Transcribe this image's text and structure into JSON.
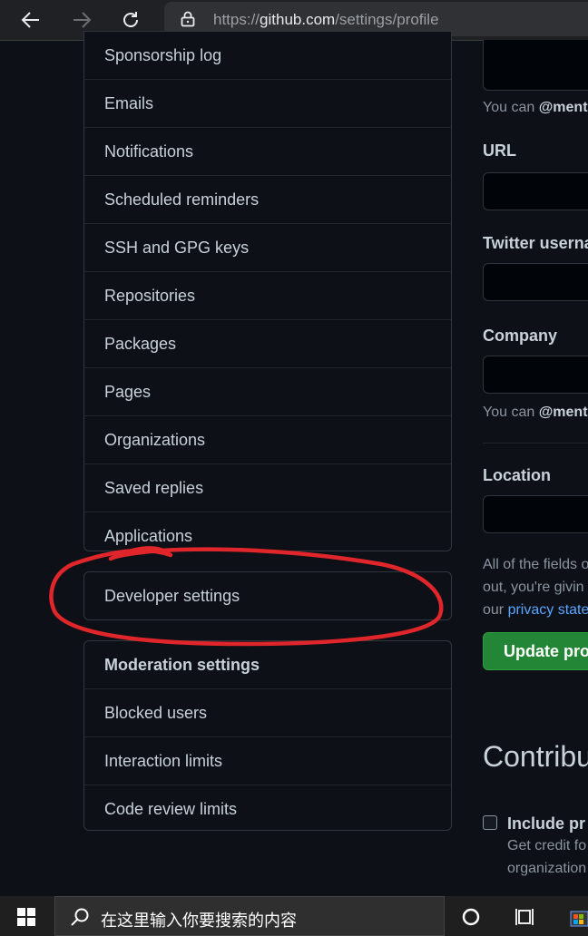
{
  "browser": {
    "url_scheme": "https://",
    "url_host": "github.com",
    "url_path": "/settings/profile"
  },
  "sidebar": {
    "group1": [
      "Sponsorship log",
      "Emails",
      "Notifications",
      "Scheduled reminders",
      "SSH and GPG keys",
      "Repositories",
      "Packages",
      "Pages",
      "Organizations",
      "Saved replies",
      "Applications"
    ],
    "developer_settings": "Developer settings",
    "moderation_heading": "Moderation settings",
    "moderation_items": [
      "Blocked users",
      "Interaction limits",
      "Code review limits"
    ]
  },
  "profile_form": {
    "mention_hint_prefix": "You can ",
    "mention_hint_bold": "@ment",
    "url_label": "URL",
    "twitter_label": "Twitter userna",
    "company_label": "Company",
    "company_hint_prefix": "You can ",
    "company_hint_bold": "@ment",
    "location_label": "Location",
    "privacy_line1": "All of the fields o",
    "privacy_line2": "out, you're givin",
    "privacy_line3_prefix": "our ",
    "privacy_link": "privacy state",
    "update_button": "Update pro",
    "contrib_heading": "Contribu",
    "include_label": "Include pr",
    "credit_line1": "Get credit fo",
    "credit_line2": "organization"
  },
  "taskbar": {
    "search_placeholder": "在这里输入你要搜索的内容"
  },
  "colors": {
    "background": "#0d1117",
    "border": "#30363d",
    "annotation": "#e0262a",
    "button_green": "#238636",
    "link": "#58a6ff"
  }
}
